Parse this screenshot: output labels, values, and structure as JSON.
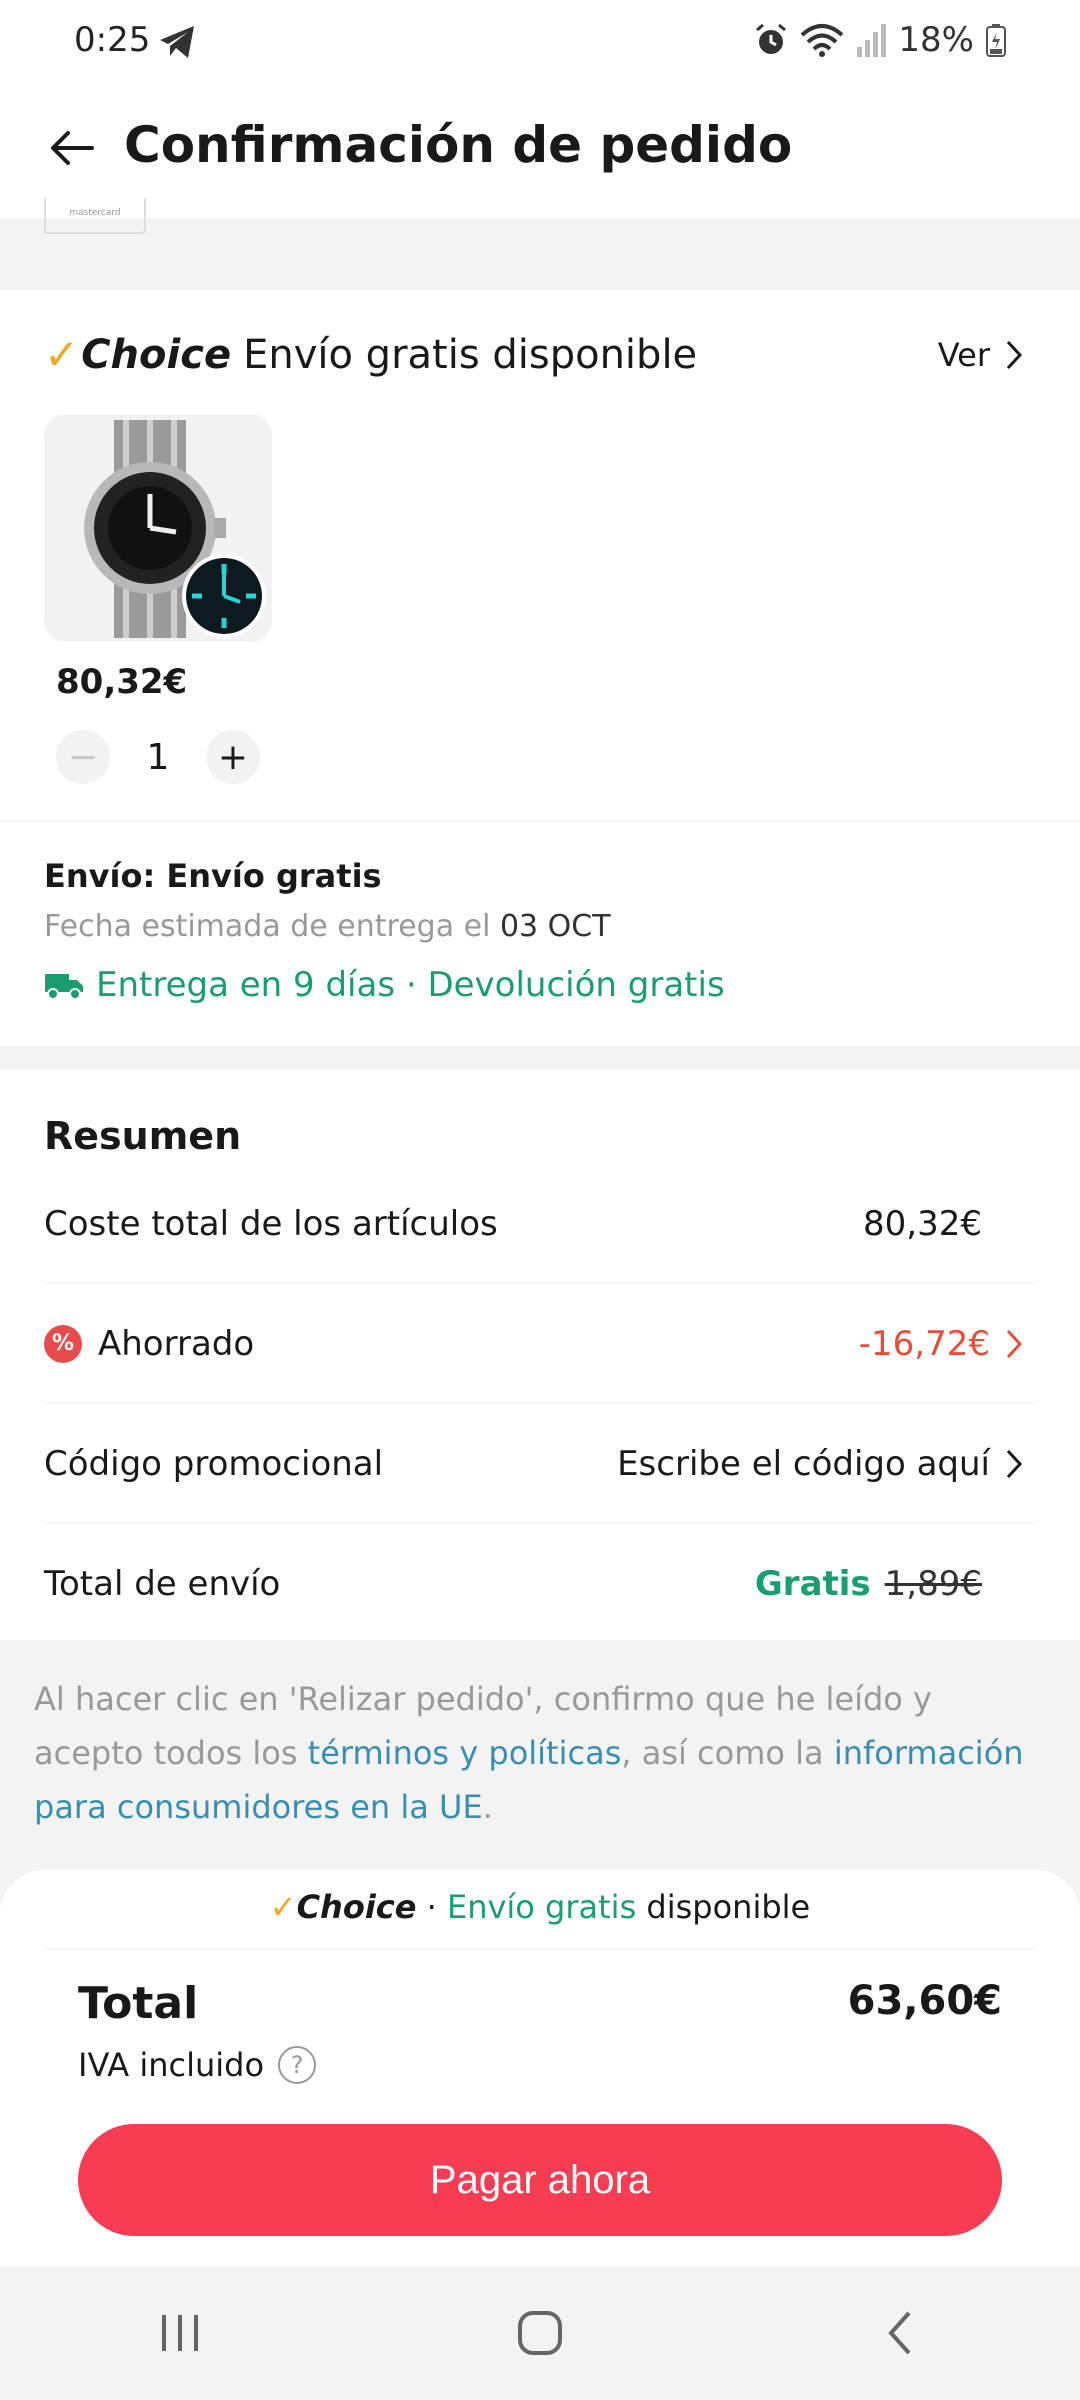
{
  "status": {
    "time": "0:25",
    "battery": "18%"
  },
  "header": {
    "title": "Confirmación de pedido",
    "peek_card_label": "mastercard"
  },
  "product_section": {
    "choice_label": "Choice",
    "choice_text": "Envío gratis disponible",
    "view_label": "Ver",
    "price": "80,32€",
    "quantity": "1"
  },
  "shipping": {
    "title": "Envío: Envío gratis",
    "date_label": "Fecha estimada de entrega el",
    "date_value": "03 OCT",
    "delivery_note": "Entrega en 9 días · Devolución gratis"
  },
  "summary": {
    "title": "Resumen",
    "items_label": "Coste total de los artículos",
    "items_value": "80,32€",
    "saved_label": "Ahorrado",
    "saved_value": "-16,72€",
    "promo_label": "Código promocional",
    "promo_placeholder": "Escribe el código aquí",
    "shipping_label": "Total de envío",
    "shipping_free": "Gratis",
    "shipping_old": "1,89€"
  },
  "terms": {
    "t1": "Al hacer clic en 'Relizar pedido', confirmo que he leído y acepto todos los ",
    "link1": "términos y políticas",
    "t2": ", así como la ",
    "link2": "información para consumidores en la UE",
    "t3": "."
  },
  "bottom": {
    "choice_label": "Choice",
    "sep": "·",
    "free_shipping": "Envío gratis",
    "available": "disponible",
    "total_label": "Total",
    "total_value": "63,60€",
    "vat_label": "IVA incluido",
    "pay_button": "Pagar ahora"
  },
  "colors": {
    "accent": "#f83c53",
    "green": "#1a9e6f",
    "choice": "#f5a623",
    "saved": "#e2503a",
    "link": "#3a8fb0"
  },
  "icons": [
    "telegram-icon",
    "alarm-icon",
    "wifi-icon",
    "signal-icon",
    "battery-icon",
    "back-arrow-icon",
    "chevron-right-icon",
    "truck-icon",
    "percent-icon",
    "help-icon",
    "recents-icon",
    "home-icon",
    "back-nav-icon"
  ]
}
